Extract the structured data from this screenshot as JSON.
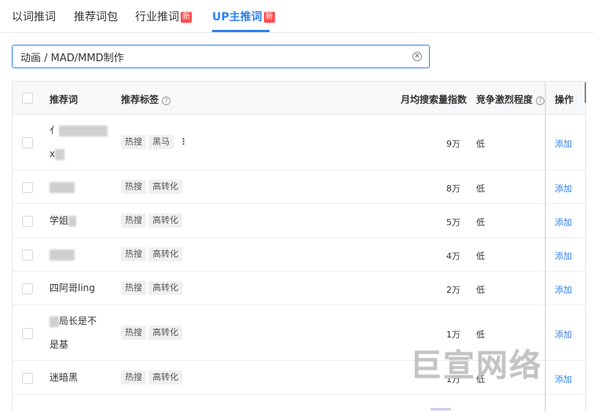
{
  "tabs": [
    {
      "label": "以词推词"
    },
    {
      "label": "推荐词包"
    },
    {
      "label": "行业推词",
      "badge": "新"
    },
    {
      "label": "UP主推词",
      "badge": "新"
    }
  ],
  "search": {
    "value": "动画 / MAD/MMD制作"
  },
  "table": {
    "headers": {
      "keyword": "推荐词",
      "tags": "推荐标签",
      "volume": "月均搜索量指数",
      "competition": "竞争激烈程度",
      "action": "操作"
    },
    "rows": [
      {
        "keyword_line1": "亻",
        "keyword_line2": "x",
        "tags": [
          "热搜",
          "黑马"
        ],
        "volume": "9万",
        "competition": "低",
        "action": "添加"
      },
      {
        "keyword": "",
        "tags": [
          "热搜",
          "高转化"
        ],
        "volume": "8万",
        "competition": "低",
        "action": "添加"
      },
      {
        "keyword": "学姐",
        "tags": [
          "热搜",
          "高转化"
        ],
        "volume": "5万",
        "competition": "低",
        "action": "添加"
      },
      {
        "keyword": "",
        "tags": [
          "热搜",
          "高转化"
        ],
        "volume": "4万",
        "competition": "低",
        "action": "添加"
      },
      {
        "keyword": "四阿哥ling",
        "tags": [
          "热搜",
          "高转化"
        ],
        "volume": "2万",
        "competition": "低",
        "action": "添加"
      },
      {
        "keyword_line1": "局长是不",
        "keyword_line2": "是基",
        "tags": [
          "热搜",
          "高转化"
        ],
        "volume": "1万",
        "competition": "低",
        "action": "添加"
      },
      {
        "keyword": "迷暗黑",
        "tags": [
          "热搜",
          "高转化"
        ],
        "volume": "1万",
        "competition": "低",
        "action": "添加"
      }
    ]
  },
  "watermark": "巨宣网络",
  "colors": {
    "accent": "#2f80ed",
    "badge": "#ff4d4f"
  }
}
